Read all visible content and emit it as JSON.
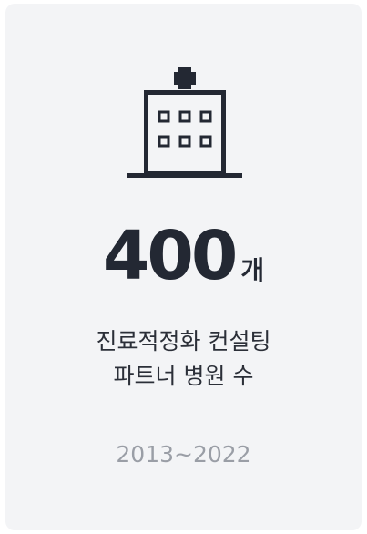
{
  "card": {
    "icon": "hospital-building-icon",
    "stat_number": "400",
    "stat_unit": "개",
    "description_line1": "진료적정화 컨설팅",
    "description_line2": "파트너 병원 수",
    "period": "2013~2022"
  },
  "colors": {
    "card_background": "#f3f4f6",
    "primary_text": "#232833",
    "icon_stroke": "#232833",
    "muted_text": "#9a9ea6"
  }
}
